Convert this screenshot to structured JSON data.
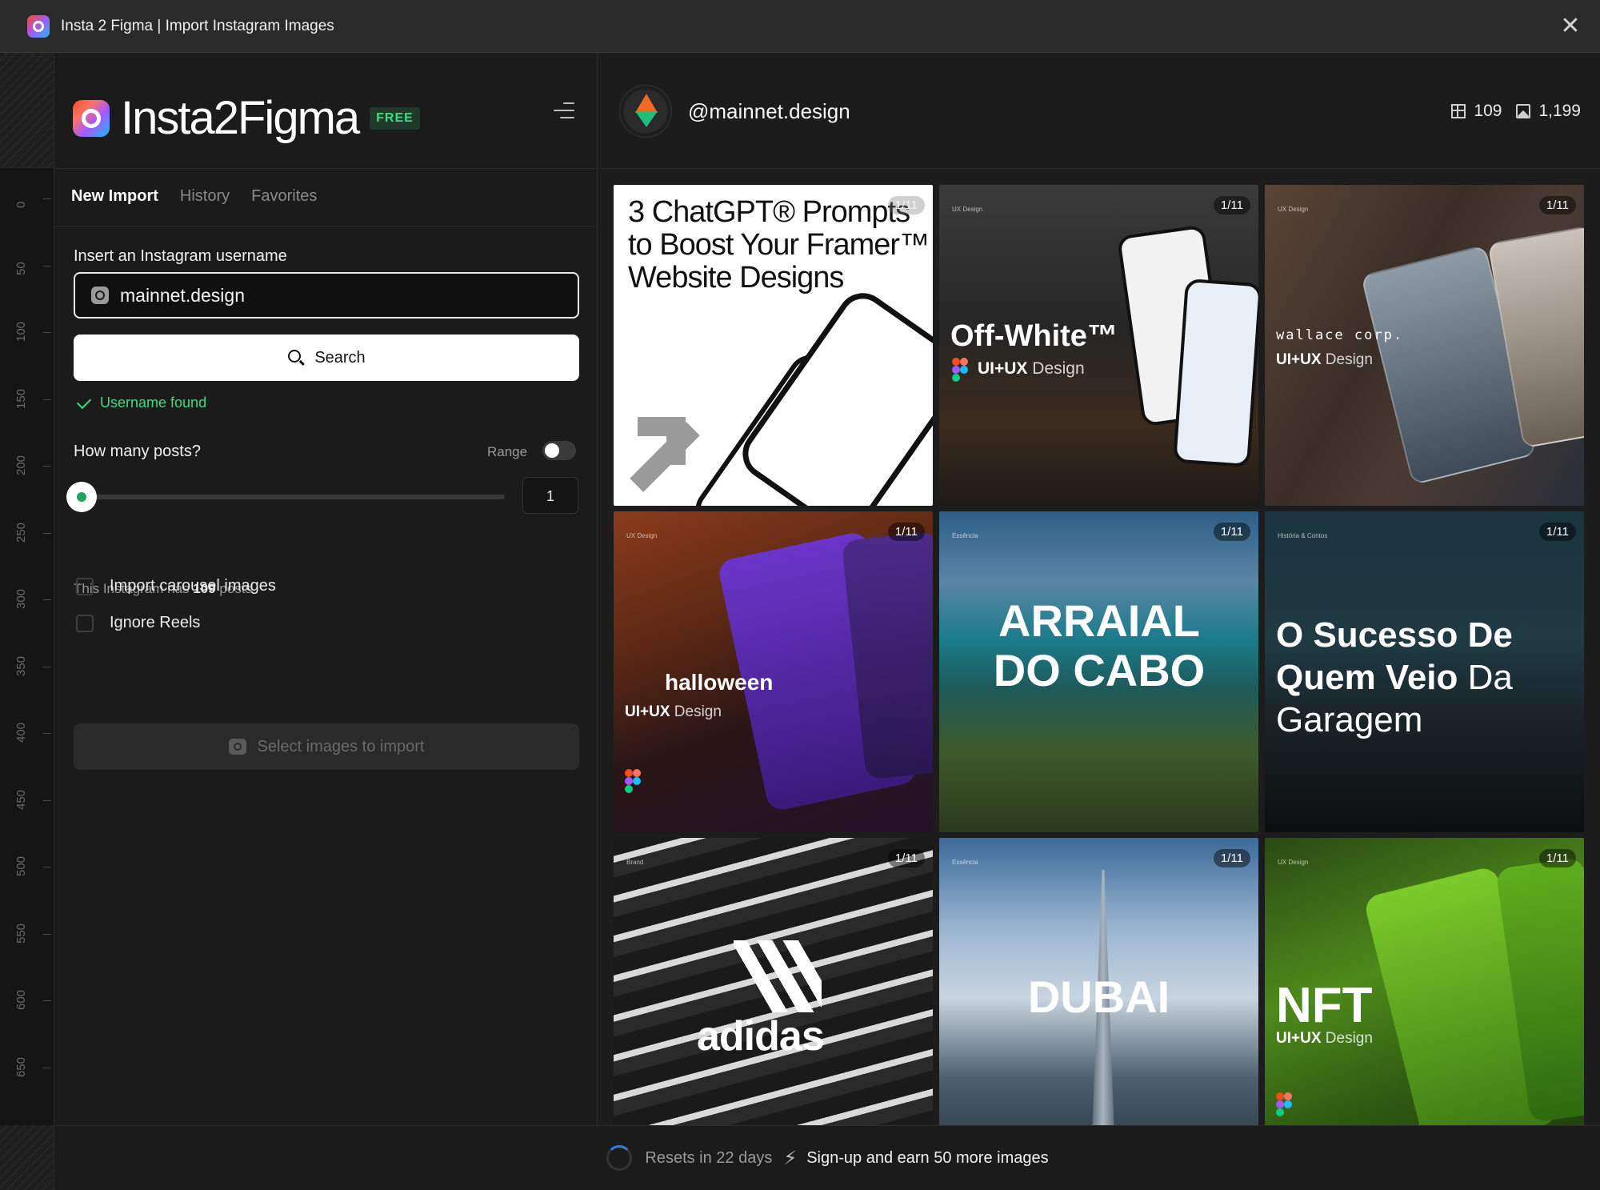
{
  "window": {
    "title": "Insta 2 Figma | Import Instagram Images"
  },
  "brand": {
    "name": "Insta2Figma",
    "badge": "FREE"
  },
  "ruler": {
    "ticks": [
      "0",
      "50",
      "100",
      "150",
      "200",
      "250",
      "300",
      "350",
      "400",
      "450",
      "500",
      "550",
      "600",
      "650"
    ]
  },
  "tabs": [
    {
      "label": "New Import",
      "active": true
    },
    {
      "label": "History",
      "active": false
    },
    {
      "label": "Favorites",
      "active": false
    }
  ],
  "form": {
    "username_label": "Insert an Instagram username",
    "username_value": "mainnet.design",
    "search_label": "Search",
    "status": "Username found",
    "posts_label": "How many posts?",
    "range_label": "Range",
    "range_enabled": false,
    "posts_count": "1",
    "slider_fraction": 0.0,
    "has_prefix": "This Instagram has",
    "has_count": "109",
    "has_suffix": "posts",
    "options": [
      {
        "label": "Import carousel images",
        "checked": false
      },
      {
        "label": "Ignore Reels",
        "checked": false
      }
    ],
    "import_label": "Select images to import"
  },
  "profile": {
    "handle": "@mainnet.design",
    "posts_count": "109",
    "images_count": "1,199"
  },
  "posts": [
    {
      "counter": "1/11",
      "title": "3 ChatGPT® Prompts to Boost Your Framer™ Website Designs"
    },
    {
      "counter": "1/11",
      "tag": "UX Design",
      "title": "Off-White™",
      "subtitle_bold": "UI+UX",
      "subtitle_light": "Design"
    },
    {
      "counter": "1/11",
      "tag": "UX Design",
      "title": "wallace corp.",
      "subtitle_bold": "UI+UX",
      "subtitle_light": "Design"
    },
    {
      "counter": "1/11",
      "tag": "UX Design",
      "title": "halloween",
      "subtitle_bold": "UI+UX",
      "subtitle_light": "Design"
    },
    {
      "counter": "1/11",
      "tag": "Essência",
      "title": "ARRAIAL DO CABO"
    },
    {
      "counter": "1/11",
      "tag": "História & Contos",
      "title_bold": "O Sucesso De Quem Veio",
      "title_light": "Da Garagem"
    },
    {
      "counter": "1/11",
      "tag": "Brand",
      "title": "adidas"
    },
    {
      "counter": "1/11",
      "tag": "Essência",
      "title": "DUBAI"
    },
    {
      "counter": "1/11",
      "tag": "UX Design",
      "title": "NFT",
      "subtitle_bold": "UI+UX",
      "subtitle_light": "Design"
    }
  ],
  "footer": {
    "resets": "Resets in 22 days",
    "signup": "Sign-up and earn 50 more images"
  }
}
